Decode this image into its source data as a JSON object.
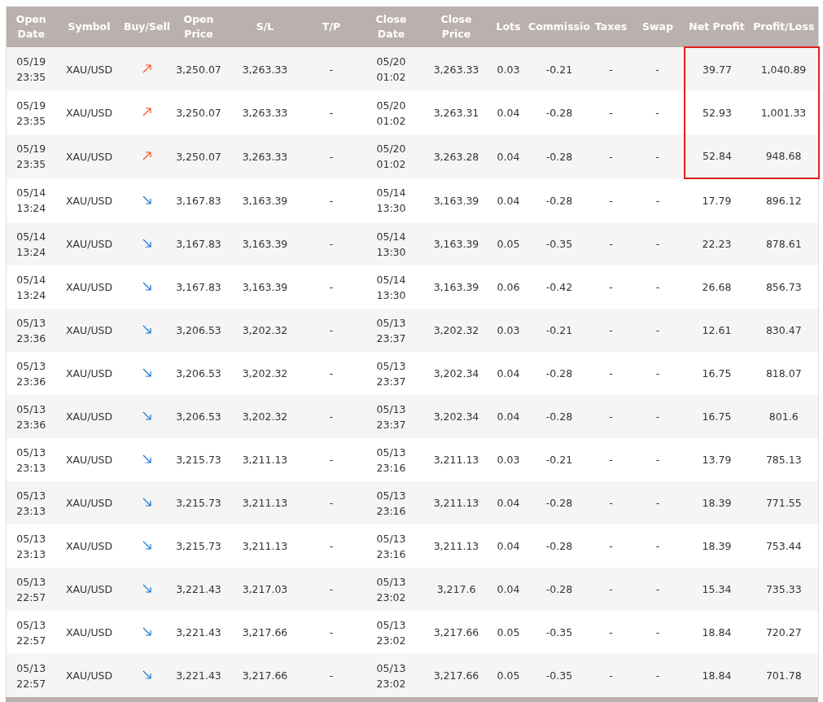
{
  "table": {
    "columns": [
      [
        "Open",
        "Date"
      ],
      [
        "Symbol"
      ],
      [
        "Buy/Sell"
      ],
      [
        "Open",
        "Price"
      ],
      [
        "S/L"
      ],
      [
        "T/P"
      ],
      [
        "Close",
        "Date"
      ],
      [
        "Close",
        "Price"
      ],
      [
        "Lots"
      ],
      [
        "Commissio"
      ],
      [
        "Taxes"
      ],
      [
        "Swap"
      ],
      [
        "Net Profit"
      ],
      [
        "Profit/Loss"
      ]
    ],
    "rows": [
      {
        "open_date": [
          "05/19",
          "23:35"
        ],
        "symbol": "XAU/USD",
        "kind": "buy",
        "open_price": "3,250.07",
        "sl": "3,263.33",
        "tp": "-",
        "close_date": [
          "05/20",
          "01:02"
        ],
        "close_price": "3,263.33",
        "lots": "0.03",
        "commission": "-0.21",
        "taxes": "-",
        "swap": "-",
        "net_profit": "39.77",
        "profit_loss": "1,040.89",
        "highlighted": true
      },
      {
        "open_date": [
          "05/19",
          "23:35"
        ],
        "symbol": "XAU/USD",
        "kind": "buy",
        "open_price": "3,250.07",
        "sl": "3,263.33",
        "tp": "-",
        "close_date": [
          "05/20",
          "01:02"
        ],
        "close_price": "3,263.31",
        "lots": "0.04",
        "commission": "-0.28",
        "taxes": "-",
        "swap": "-",
        "net_profit": "52.93",
        "profit_loss": "1,001.33",
        "highlighted": true
      },
      {
        "open_date": [
          "05/19",
          "23:35"
        ],
        "symbol": "XAU/USD",
        "kind": "buy",
        "open_price": "3,250.07",
        "sl": "3,263.33",
        "tp": "-",
        "close_date": [
          "05/20",
          "01:02"
        ],
        "close_price": "3,263.28",
        "lots": "0.04",
        "commission": "-0.28",
        "taxes": "-",
        "swap": "-",
        "net_profit": "52.84",
        "profit_loss": "948.68",
        "highlighted": true
      },
      {
        "open_date": [
          "05/14",
          "13:24"
        ],
        "symbol": "XAU/USD",
        "kind": "sell",
        "open_price": "3,167.83",
        "sl": "3,163.39",
        "tp": "-",
        "close_date": [
          "05/14",
          "13:30"
        ],
        "close_price": "3,163.39",
        "lots": "0.04",
        "commission": "-0.28",
        "taxes": "-",
        "swap": "-",
        "net_profit": "17.79",
        "profit_loss": "896.12",
        "highlighted": false
      },
      {
        "open_date": [
          "05/14",
          "13:24"
        ],
        "symbol": "XAU/USD",
        "kind": "sell",
        "open_price": "3,167.83",
        "sl": "3,163.39",
        "tp": "-",
        "close_date": [
          "05/14",
          "13:30"
        ],
        "close_price": "3,163.39",
        "lots": "0.05",
        "commission": "-0.35",
        "taxes": "-",
        "swap": "-",
        "net_profit": "22.23",
        "profit_loss": "878.61",
        "highlighted": false
      },
      {
        "open_date": [
          "05/14",
          "13:24"
        ],
        "symbol": "XAU/USD",
        "kind": "sell",
        "open_price": "3,167.83",
        "sl": "3,163.39",
        "tp": "-",
        "close_date": [
          "05/14",
          "13:30"
        ],
        "close_price": "3,163.39",
        "lots": "0.06",
        "commission": "-0.42",
        "taxes": "-",
        "swap": "-",
        "net_profit": "26.68",
        "profit_loss": "856.73",
        "highlighted": false
      },
      {
        "open_date": [
          "05/13",
          "23:36"
        ],
        "symbol": "XAU/USD",
        "kind": "sell",
        "open_price": "3,206.53",
        "sl": "3,202.32",
        "tp": "-",
        "close_date": [
          "05/13",
          "23:37"
        ],
        "close_price": "3,202.32",
        "lots": "0.03",
        "commission": "-0.21",
        "taxes": "-",
        "swap": "-",
        "net_profit": "12.61",
        "profit_loss": "830.47",
        "highlighted": false
      },
      {
        "open_date": [
          "05/13",
          "23:36"
        ],
        "symbol": "XAU/USD",
        "kind": "sell",
        "open_price": "3,206.53",
        "sl": "3,202.32",
        "tp": "-",
        "close_date": [
          "05/13",
          "23:37"
        ],
        "close_price": "3,202.34",
        "lots": "0.04",
        "commission": "-0.28",
        "taxes": "-",
        "swap": "-",
        "net_profit": "16.75",
        "profit_loss": "818.07",
        "highlighted": false
      },
      {
        "open_date": [
          "05/13",
          "23:36"
        ],
        "symbol": "XAU/USD",
        "kind": "sell",
        "open_price": "3,206.53",
        "sl": "3,202.32",
        "tp": "-",
        "close_date": [
          "05/13",
          "23:37"
        ],
        "close_price": "3,202.34",
        "lots": "0.04",
        "commission": "-0.28",
        "taxes": "-",
        "swap": "-",
        "net_profit": "16.75",
        "profit_loss": "801.6",
        "highlighted": false
      },
      {
        "open_date": [
          "05/13",
          "23:13"
        ],
        "symbol": "XAU/USD",
        "kind": "sell",
        "open_price": "3,215.73",
        "sl": "3,211.13",
        "tp": "-",
        "close_date": [
          "05/13",
          "23:16"
        ],
        "close_price": "3,211.13",
        "lots": "0.03",
        "commission": "-0.21",
        "taxes": "-",
        "swap": "-",
        "net_profit": "13.79",
        "profit_loss": "785.13",
        "highlighted": false
      },
      {
        "open_date": [
          "05/13",
          "23:13"
        ],
        "symbol": "XAU/USD",
        "kind": "sell",
        "open_price": "3,215.73",
        "sl": "3,211.13",
        "tp": "-",
        "close_date": [
          "05/13",
          "23:16"
        ],
        "close_price": "3,211.13",
        "lots": "0.04",
        "commission": "-0.28",
        "taxes": "-",
        "swap": "-",
        "net_profit": "18.39",
        "profit_loss": "771.55",
        "highlighted": false
      },
      {
        "open_date": [
          "05/13",
          "23:13"
        ],
        "symbol": "XAU/USD",
        "kind": "sell",
        "open_price": "3,215.73",
        "sl": "3,211.13",
        "tp": "-",
        "close_date": [
          "05/13",
          "23:16"
        ],
        "close_price": "3,211.13",
        "lots": "0.04",
        "commission": "-0.28",
        "taxes": "-",
        "swap": "-",
        "net_profit": "18.39",
        "profit_loss": "753.44",
        "highlighted": false
      },
      {
        "open_date": [
          "05/13",
          "22:57"
        ],
        "symbol": "XAU/USD",
        "kind": "sell",
        "open_price": "3,221.43",
        "sl": "3,217.03",
        "tp": "-",
        "close_date": [
          "05/13",
          "23:02"
        ],
        "close_price": "3,217.6",
        "lots": "0.04",
        "commission": "-0.28",
        "taxes": "-",
        "swap": "-",
        "net_profit": "15.34",
        "profit_loss": "735.33",
        "highlighted": false
      },
      {
        "open_date": [
          "05/13",
          "22:57"
        ],
        "symbol": "XAU/USD",
        "kind": "sell",
        "open_price": "3,221.43",
        "sl": "3,217.66",
        "tp": "-",
        "close_date": [
          "05/13",
          "23:02"
        ],
        "close_price": "3,217.66",
        "lots": "0.05",
        "commission": "-0.35",
        "taxes": "-",
        "swap": "-",
        "net_profit": "18.84",
        "profit_loss": "720.27",
        "highlighted": false
      },
      {
        "open_date": [
          "05/13",
          "22:57"
        ],
        "symbol": "XAU/USD",
        "kind": "sell",
        "open_price": "3,221.43",
        "sl": "3,217.66",
        "tp": "-",
        "close_date": [
          "05/13",
          "23:02"
        ],
        "close_price": "3,217.66",
        "lots": "0.05",
        "commission": "-0.35",
        "taxes": "-",
        "swap": "-",
        "net_profit": "18.84",
        "profit_loss": "701.78",
        "highlighted": false
      }
    ]
  }
}
